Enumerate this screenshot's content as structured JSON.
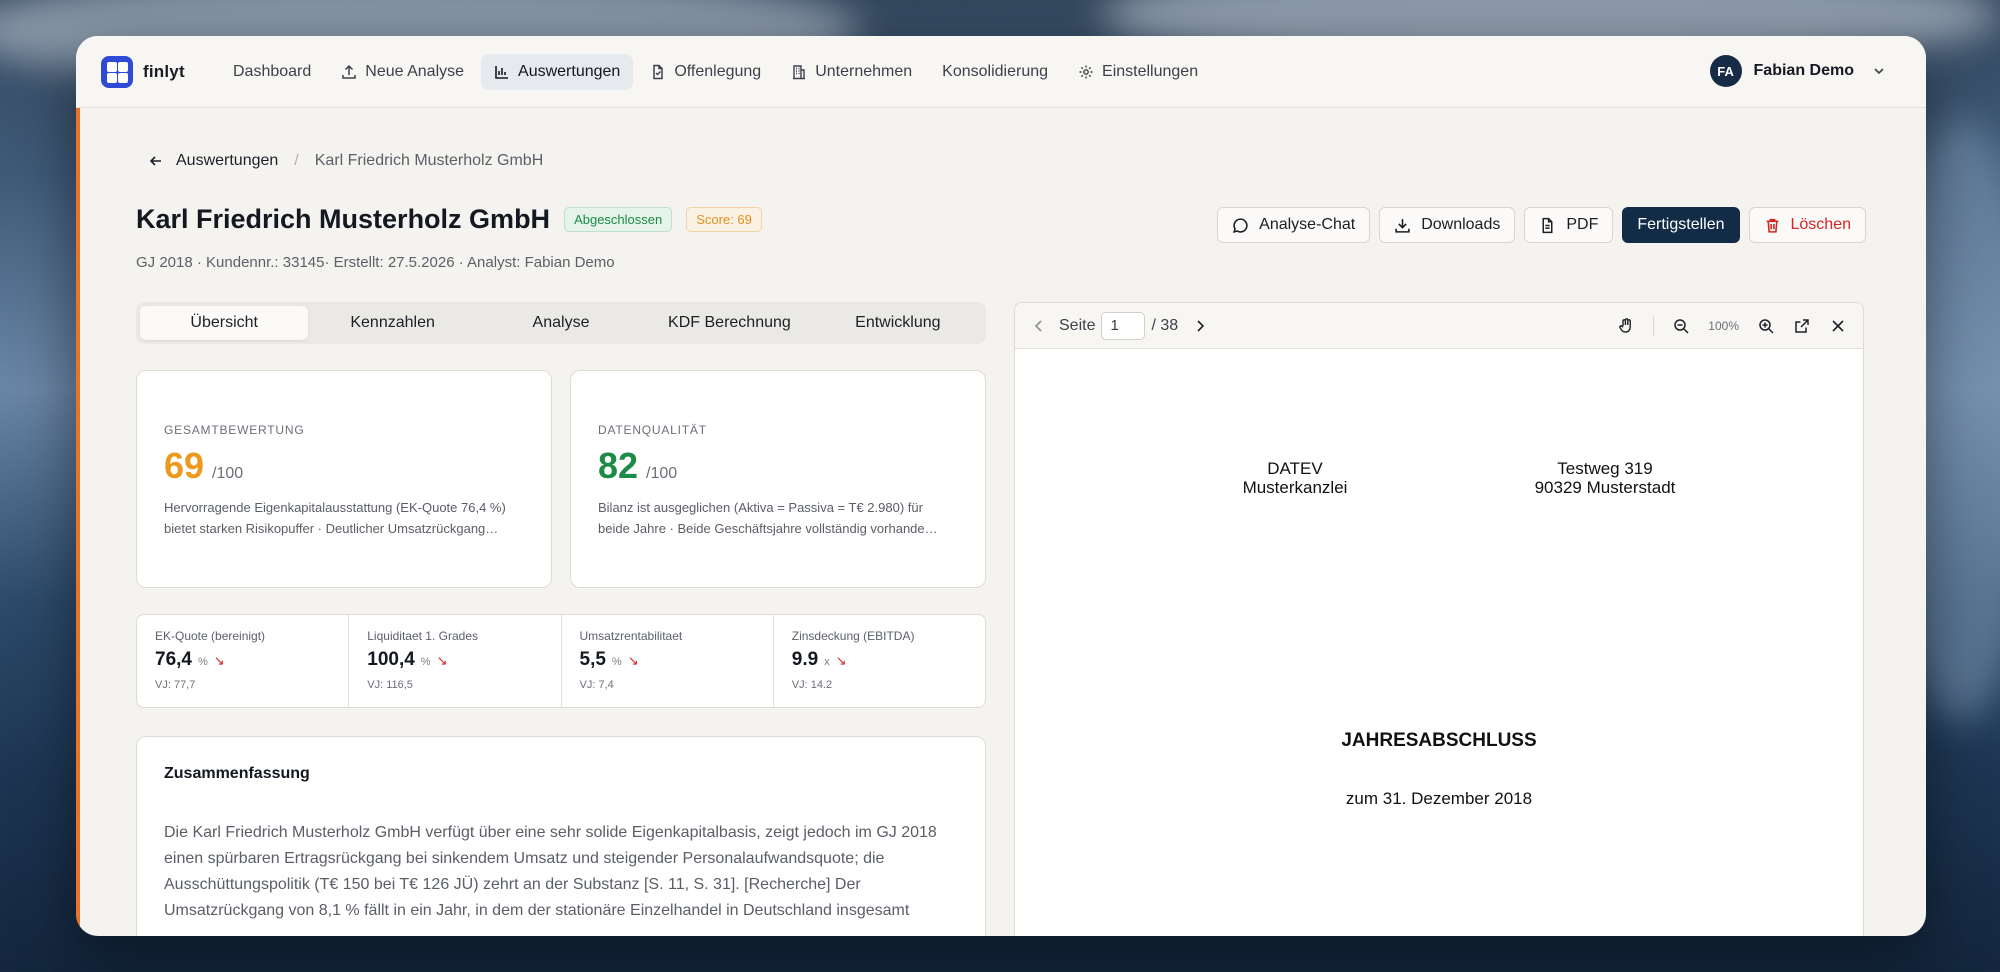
{
  "nav": {
    "logo": "finlyt",
    "items": [
      {
        "label": "Dashboard",
        "icon": "none"
      },
      {
        "label": "Neue Analyse",
        "icon": "upload-icon"
      },
      {
        "label": "Auswertungen",
        "icon": "bar-chart-icon",
        "active": true
      },
      {
        "label": "Offenlegung",
        "icon": "document-icon"
      },
      {
        "label": "Unternehmen",
        "icon": "building-icon"
      },
      {
        "label": "Konsolidierung",
        "icon": "none"
      },
      {
        "label": "Einstellungen",
        "icon": "gear-icon"
      }
    ],
    "user": {
      "initials": "FA",
      "name": "Fabian Demo"
    }
  },
  "breadcrumb": {
    "back": "Auswertungen",
    "current": "Karl Friedrich Musterholz GmbH"
  },
  "header": {
    "title": "Karl Friedrich Musterholz GmbH",
    "status_badge": "Abgeschlossen",
    "score_badge": "Score: 69",
    "subtitle": "GJ 2018 · Kundennr.: 33145· Erstellt: 27.5.2026 · Analyst: Fabian Demo",
    "actions": {
      "chat": "Analyse-Chat",
      "downloads": "Downloads",
      "pdf": "PDF",
      "finish": "Fertigstellen",
      "delete": "Löschen"
    }
  },
  "tabs": [
    "Übersicht",
    "Kennzahlen",
    "Analyse",
    "KDF Berechnung",
    "Entwicklung"
  ],
  "scores": {
    "overall": {
      "label": "GESAMTBEWERTUNG",
      "value": "69",
      "max": "/100",
      "color": "#ec9a1e",
      "text": "Hervorragende Eigenkapitalausstattung (EK-Quote 76,4 %) bietet starken Risikopuffer · Deutlicher Umsatzrückgang…"
    },
    "data_quality": {
      "label": "DATENQUALITÄT",
      "value": "82",
      "max": "/100",
      "color": "#1d8a46",
      "text": "Bilanz ist ausgeglichen (Aktiva = Passiva = T€ 2.980) für beide Jahre · Beide Geschäftsjahre vollständig vorhande…"
    }
  },
  "kpis": [
    {
      "label": "EK-Quote (bereinigt)",
      "value": "76,4",
      "unit": "%",
      "prev": "VJ: 77,7"
    },
    {
      "label": "Liquiditaet 1. Grades",
      "value": "100,4",
      "unit": "%",
      "prev": "VJ: 116,5"
    },
    {
      "label": "Umsatzrentabilitaet",
      "value": "5,5",
      "unit": "%",
      "prev": "VJ: 7,4"
    },
    {
      "label": "Zinsdeckung (EBITDA)",
      "value": "9.9",
      "unit": "x",
      "prev": "VJ: 14.2"
    }
  ],
  "summary": {
    "title": "Zusammenfassung",
    "text": "Die Karl Friedrich Musterholz GmbH verfügt über eine sehr solide Eigenkapitalbasis, zeigt jedoch im GJ 2018 einen spürbaren Ertragsrückgang bei sinkendem Umsatz und steigender Personalaufwandsquote; die Ausschüttungspolitik (T€ 150 bei T€ 126 JÜ) zehrt an der Substanz [S. 11, S. 31]. [Recherche] Der Umsatzrückgang von 8,1 % fällt in ein Jahr, in dem der stationäre Einzelhandel in Deutschland insgesamt"
  },
  "viewer": {
    "page_label": "Seite",
    "page": "1",
    "total": "/ 38",
    "zoom": "100%",
    "doc": {
      "left_line1": "DATEV",
      "left_line2": "Musterkanzlei",
      "right_line1": "Testweg 319",
      "right_line2": "90329 Musterstadt",
      "heading": "JAHRESABSCHLUSS",
      "date": "zum 31. Dezember 2018"
    }
  }
}
